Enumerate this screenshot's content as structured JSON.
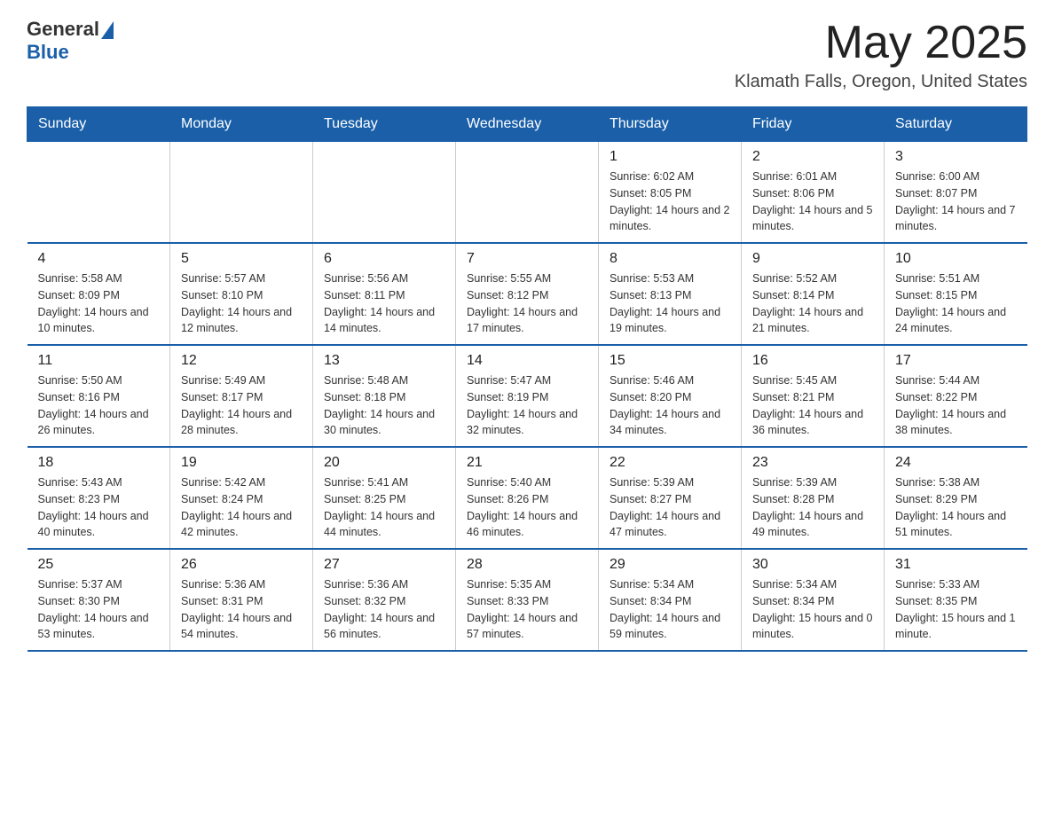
{
  "header": {
    "logo_general": "General",
    "logo_blue": "Blue",
    "month_title": "May 2025",
    "location": "Klamath Falls, Oregon, United States"
  },
  "days_of_week": [
    "Sunday",
    "Monday",
    "Tuesday",
    "Wednesday",
    "Thursday",
    "Friday",
    "Saturday"
  ],
  "weeks": [
    [
      {
        "day": "",
        "info": ""
      },
      {
        "day": "",
        "info": ""
      },
      {
        "day": "",
        "info": ""
      },
      {
        "day": "",
        "info": ""
      },
      {
        "day": "1",
        "info": "Sunrise: 6:02 AM\nSunset: 8:05 PM\nDaylight: 14 hours and 2 minutes."
      },
      {
        "day": "2",
        "info": "Sunrise: 6:01 AM\nSunset: 8:06 PM\nDaylight: 14 hours and 5 minutes."
      },
      {
        "day": "3",
        "info": "Sunrise: 6:00 AM\nSunset: 8:07 PM\nDaylight: 14 hours and 7 minutes."
      }
    ],
    [
      {
        "day": "4",
        "info": "Sunrise: 5:58 AM\nSunset: 8:09 PM\nDaylight: 14 hours and 10 minutes."
      },
      {
        "day": "5",
        "info": "Sunrise: 5:57 AM\nSunset: 8:10 PM\nDaylight: 14 hours and 12 minutes."
      },
      {
        "day": "6",
        "info": "Sunrise: 5:56 AM\nSunset: 8:11 PM\nDaylight: 14 hours and 14 minutes."
      },
      {
        "day": "7",
        "info": "Sunrise: 5:55 AM\nSunset: 8:12 PM\nDaylight: 14 hours and 17 minutes."
      },
      {
        "day": "8",
        "info": "Sunrise: 5:53 AM\nSunset: 8:13 PM\nDaylight: 14 hours and 19 minutes."
      },
      {
        "day": "9",
        "info": "Sunrise: 5:52 AM\nSunset: 8:14 PM\nDaylight: 14 hours and 21 minutes."
      },
      {
        "day": "10",
        "info": "Sunrise: 5:51 AM\nSunset: 8:15 PM\nDaylight: 14 hours and 24 minutes."
      }
    ],
    [
      {
        "day": "11",
        "info": "Sunrise: 5:50 AM\nSunset: 8:16 PM\nDaylight: 14 hours and 26 minutes."
      },
      {
        "day": "12",
        "info": "Sunrise: 5:49 AM\nSunset: 8:17 PM\nDaylight: 14 hours and 28 minutes."
      },
      {
        "day": "13",
        "info": "Sunrise: 5:48 AM\nSunset: 8:18 PM\nDaylight: 14 hours and 30 minutes."
      },
      {
        "day": "14",
        "info": "Sunrise: 5:47 AM\nSunset: 8:19 PM\nDaylight: 14 hours and 32 minutes."
      },
      {
        "day": "15",
        "info": "Sunrise: 5:46 AM\nSunset: 8:20 PM\nDaylight: 14 hours and 34 minutes."
      },
      {
        "day": "16",
        "info": "Sunrise: 5:45 AM\nSunset: 8:21 PM\nDaylight: 14 hours and 36 minutes."
      },
      {
        "day": "17",
        "info": "Sunrise: 5:44 AM\nSunset: 8:22 PM\nDaylight: 14 hours and 38 minutes."
      }
    ],
    [
      {
        "day": "18",
        "info": "Sunrise: 5:43 AM\nSunset: 8:23 PM\nDaylight: 14 hours and 40 minutes."
      },
      {
        "day": "19",
        "info": "Sunrise: 5:42 AM\nSunset: 8:24 PM\nDaylight: 14 hours and 42 minutes."
      },
      {
        "day": "20",
        "info": "Sunrise: 5:41 AM\nSunset: 8:25 PM\nDaylight: 14 hours and 44 minutes."
      },
      {
        "day": "21",
        "info": "Sunrise: 5:40 AM\nSunset: 8:26 PM\nDaylight: 14 hours and 46 minutes."
      },
      {
        "day": "22",
        "info": "Sunrise: 5:39 AM\nSunset: 8:27 PM\nDaylight: 14 hours and 47 minutes."
      },
      {
        "day": "23",
        "info": "Sunrise: 5:39 AM\nSunset: 8:28 PM\nDaylight: 14 hours and 49 minutes."
      },
      {
        "day": "24",
        "info": "Sunrise: 5:38 AM\nSunset: 8:29 PM\nDaylight: 14 hours and 51 minutes."
      }
    ],
    [
      {
        "day": "25",
        "info": "Sunrise: 5:37 AM\nSunset: 8:30 PM\nDaylight: 14 hours and 53 minutes."
      },
      {
        "day": "26",
        "info": "Sunrise: 5:36 AM\nSunset: 8:31 PM\nDaylight: 14 hours and 54 minutes."
      },
      {
        "day": "27",
        "info": "Sunrise: 5:36 AM\nSunset: 8:32 PM\nDaylight: 14 hours and 56 minutes."
      },
      {
        "day": "28",
        "info": "Sunrise: 5:35 AM\nSunset: 8:33 PM\nDaylight: 14 hours and 57 minutes."
      },
      {
        "day": "29",
        "info": "Sunrise: 5:34 AM\nSunset: 8:34 PM\nDaylight: 14 hours and 59 minutes."
      },
      {
        "day": "30",
        "info": "Sunrise: 5:34 AM\nSunset: 8:34 PM\nDaylight: 15 hours and 0 minutes."
      },
      {
        "day": "31",
        "info": "Sunrise: 5:33 AM\nSunset: 8:35 PM\nDaylight: 15 hours and 1 minute."
      }
    ]
  ]
}
